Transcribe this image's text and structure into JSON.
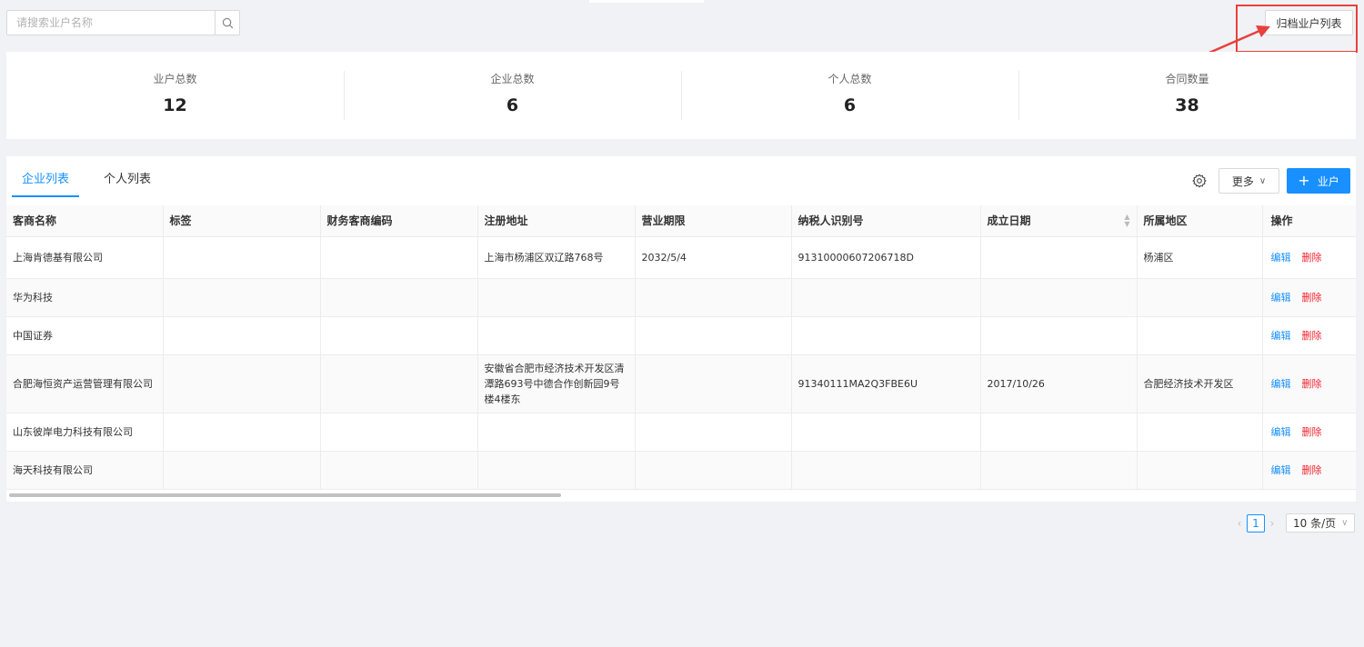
{
  "search": {
    "placeholder": "请搜索业户名称",
    "icon": "search-icon"
  },
  "archive_button": "归档业户列表",
  "stats": [
    {
      "label": "业户总数",
      "value": "12"
    },
    {
      "label": "企业总数",
      "value": "6"
    },
    {
      "label": "个人总数",
      "value": "6"
    },
    {
      "label": "合同数量",
      "value": "38"
    }
  ],
  "tabs": [
    {
      "label": "企业列表",
      "active": true
    },
    {
      "label": "个人列表",
      "active": false
    }
  ],
  "toolbar": {
    "more_label": "更多",
    "add_label": "业户",
    "settings_icon": "gear-icon"
  },
  "table": {
    "columns": [
      "客商名称",
      "标签",
      "财务客商编码",
      "注册地址",
      "营业期限",
      "纳税人识别号",
      "成立日期",
      "所属地区",
      "操作"
    ],
    "rows": [
      {
        "name": "上海肯德基有限公司",
        "tag": "",
        "code": "",
        "address": "上海市杨浦区双辽路768号",
        "term": "2032/5/4",
        "tax_id": "91310000607206718D",
        "founded": "",
        "region": "杨浦区"
      },
      {
        "name": "华为科技",
        "tag": "",
        "code": "",
        "address": "",
        "term": "",
        "tax_id": "",
        "founded": "",
        "region": ""
      },
      {
        "name": "中国证券",
        "tag": "",
        "code": "",
        "address": "",
        "term": "",
        "tax_id": "",
        "founded": "",
        "region": ""
      },
      {
        "name": "合肥海恒资产运营管理有限公司",
        "tag": "",
        "code": "",
        "address": "安徽省合肥市经济技术开发区清潭路693号中德合作创新园9号楼4楼东",
        "term": "",
        "tax_id": "91340111MA2Q3FBE6U",
        "founded": "2017/10/26",
        "region": "合肥经济技术开发区"
      },
      {
        "name": "山东彼岸电力科技有限公司",
        "tag": "",
        "code": "",
        "address": "",
        "term": "",
        "tax_id": "",
        "founded": "",
        "region": ""
      },
      {
        "name": "海天科技有限公司",
        "tag": "",
        "code": "",
        "address": "",
        "term": "",
        "tax_id": "",
        "founded": "",
        "region": ""
      }
    ],
    "action_edit": "编辑",
    "action_delete": "删除"
  },
  "pagination": {
    "current_page": "1",
    "page_size": "10 条/页"
  },
  "colors": {
    "primary": "#1890ff",
    "danger": "#f5222d",
    "annotation": "#e8403c"
  }
}
